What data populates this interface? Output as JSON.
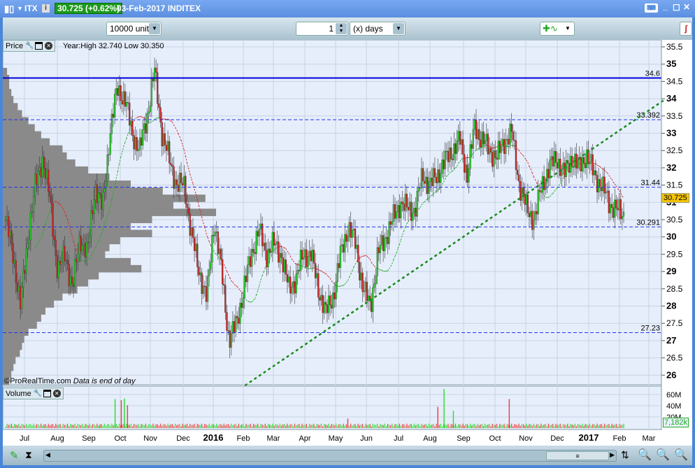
{
  "titlebar": {
    "symbol": "ITX",
    "price_change": "30.725 (+0.62%)",
    "date_name": "03-Feb-2017 INDITEX",
    "info_icon": "i"
  },
  "toolbar": {
    "units": "10000 units",
    "period_value": "1",
    "period_unit": "(x) days"
  },
  "price_panel": {
    "label": "Price",
    "info": "Year:High 32.740 Low 30.350",
    "copyright": "©ProRealTime.com",
    "note": "Data is end of day",
    "current_price": "30.725",
    "y_ticks": [
      "35.5",
      "35",
      "34.5",
      "34",
      "33.5",
      "33",
      "32.5",
      "32",
      "31.5",
      "31",
      "30.5",
      "30",
      "29.5",
      "29",
      "28.5",
      "28",
      "27.5",
      "27",
      "26.5",
      "26"
    ],
    "levels": [
      {
        "label": "34.6",
        "value": 34.6,
        "style": "solid"
      },
      {
        "label": "33.392",
        "value": 33.392,
        "style": "dashed"
      },
      {
        "label": "31.44",
        "value": 31.44,
        "style": "dashed"
      },
      {
        "label": "30.291",
        "value": 30.291,
        "style": "dashed"
      },
      {
        "label": "27.23",
        "value": 27.23,
        "style": "dashed"
      }
    ],
    "trendline": {
      "from": [
        0.39,
        25.7
      ],
      "to": [
        1.065,
        33.96
      ]
    },
    "colors": {
      "up": "#22cc22",
      "down": "#cc2222",
      "level": "#0000dd",
      "trend": "#1a8a1a",
      "price_tag": "#f5c400"
    }
  },
  "chart_data": {
    "type": "candlestick",
    "closes": [
      30.5,
      29.5,
      28.0,
      30.0,
      31.5,
      32.3,
      31.0,
      29.0,
      29.5,
      28.5,
      30.0,
      29.5,
      31.5,
      30.8,
      33.0,
      34.3,
      34.0,
      33.0,
      32.5,
      33.5,
      34.8,
      33.0,
      32.2,
      31.5,
      31.5,
      30.0,
      29.0,
      28.2,
      30.5,
      29.0,
      27.0,
      27.5,
      28.5,
      29.5,
      30.2,
      29.5,
      29.8,
      29.5,
      28.5,
      28.8,
      29.5,
      29.5,
      28.5,
      27.8,
      28.3,
      29.5,
      30.3,
      29.8,
      28.5,
      28.0,
      29.5,
      30.0,
      30.5,
      31.0,
      30.8,
      30.8,
      31.8,
      31.5,
      31.8,
      32.2,
      32.5,
      32.8,
      31.8,
      33.2,
      32.8,
      32.5,
      32.3,
      32.8,
      33.0,
      31.5,
      30.8,
      30.5,
      31.5,
      32.0,
      32.3,
      31.8,
      32.3,
      32.0,
      32.4,
      31.8,
      31.5,
      31.0,
      30.8,
      30.6
    ],
    "volume_profile": [
      2,
      3,
      3,
      4,
      5,
      7,
      9,
      12,
      15,
      18,
      22,
      28,
      30,
      34,
      40,
      50,
      60,
      75,
      95,
      80,
      100,
      70,
      60,
      70,
      55,
      50,
      48,
      60,
      65,
      45,
      40,
      35,
      28,
      24,
      20,
      18,
      16,
      12,
      10,
      9,
      8,
      6,
      5,
      4,
      3
    ],
    "volume_spikes": [
      {
        "pos": 0.36,
        "v": 52
      },
      {
        "pos": 0.38,
        "v": 50
      },
      {
        "pos": 0.39,
        "v": 53
      },
      {
        "pos": 0.4,
        "v": 41
      },
      {
        "pos": 0.845,
        "v": 70
      },
      {
        "pos": 0.835,
        "v": 38
      },
      {
        "pos": 0.86,
        "v": 31
      },
      {
        "pos": 0.95,
        "v": 52
      },
      {
        "pos": 0.31,
        "v": 4
      },
      {
        "pos": 0.69,
        "v": 17
      }
    ],
    "volume_ticks": [
      "60M",
      "40M",
      "20M"
    ],
    "volume_value": "7,182k"
  },
  "volume_panel": {
    "label": "Volume"
  },
  "x_axis": {
    "labels": [
      "Jul",
      "Aug",
      "Sep",
      "Oct",
      "Nov",
      "Dec",
      "2016",
      "Feb",
      "Mar",
      "Apr",
      "May",
      "Jun",
      "Jul",
      "Aug",
      "Sep",
      "Oct",
      "Nov",
      "Dec",
      "2017",
      "Feb",
      "Mar"
    ]
  }
}
